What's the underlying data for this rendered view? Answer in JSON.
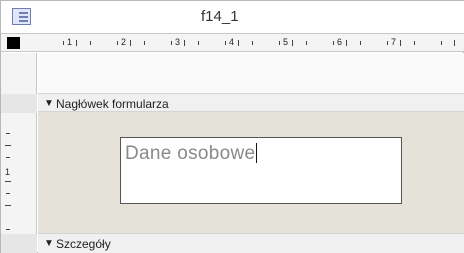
{
  "window": {
    "title": "f14_1",
    "icon": "form-icon"
  },
  "ruler": {
    "numbers": [
      "1",
      "2",
      "3",
      "4",
      "5",
      "6",
      "7"
    ],
    "vertical_numbers": [
      "1"
    ]
  },
  "sections": {
    "header_label": "Nagłówek formularza",
    "detail_label": "Szczegóły"
  },
  "textbox": {
    "value": "Dane osobowe"
  }
}
